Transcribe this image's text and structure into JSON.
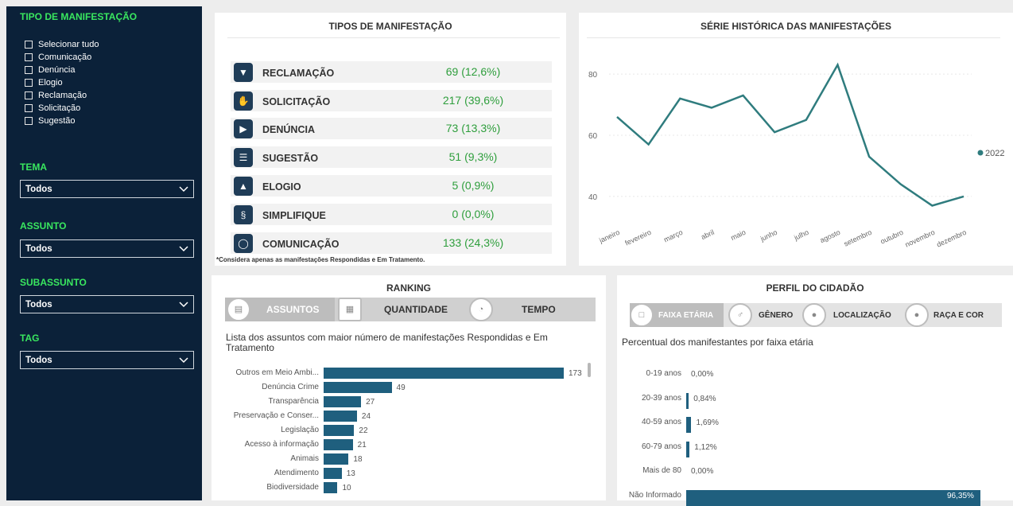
{
  "sidebar": {
    "tipo_title": "TIPO DE MANIFESTAÇÃO",
    "tipo_options": [
      "Selecionar tudo",
      "Comunicação",
      "Denúncia",
      "Elogio",
      "Reclamação",
      "Solicitação",
      "Sugestão"
    ],
    "tema_title": "TEMA",
    "tema_value": "Todos",
    "assunto_title": "ASSUNTO",
    "assunto_value": "Todos",
    "subassunto_title": "SUBASSUNTO",
    "subassunto_value": "Todos",
    "tag_title": "TAG",
    "tag_value": "Todos"
  },
  "tipos": {
    "title": "TIPOS DE MANIFESTAÇÃO",
    "rows": [
      {
        "label": "RECLAMAÇÃO",
        "value": "69 (12,6%)"
      },
      {
        "label": "SOLICITAÇÃO",
        "value": "217 (39,6%)"
      },
      {
        "label": "DENÚNCIA",
        "value": "73 (13,3%)"
      },
      {
        "label": "SUGESTÃO",
        "value": "51 (9,3%)"
      },
      {
        "label": "ELOGIO",
        "value": "5 (0,9%)"
      },
      {
        "label": "SIMPLIFIQUE",
        "value": "0 (0,0%)"
      },
      {
        "label": "COMUNICAÇÃO",
        "value": "133 (24,3%)"
      }
    ],
    "footnote": "*Considera apenas as manifestações Respondidas e Em Tratamento."
  },
  "serie": {
    "title": "SÉRIE HISTÓRICA DAS MANIFESTAÇÕES"
  },
  "ranking": {
    "title": "RANKING",
    "tabs": [
      "ASSUNTOS",
      "QUANTIDADE",
      "TEMPO"
    ],
    "subtitle": "Lista dos assuntos com maior número de manifestações Respondidas e Em Tratamento"
  },
  "perfil": {
    "title": "PERFIL DO CIDADÃO",
    "tabs": [
      "FAIXA ETÁRIA",
      "GÊNERO",
      "LOCALIZAÇÃO",
      "RAÇA E COR"
    ],
    "subtitle": "Percentual dos manifestantes por faixa etária"
  },
  "colors": {
    "accent_green": "#39e75f",
    "line": "#2f7c7e",
    "bar": "#1f5f7e",
    "sidebar": "#0b2139"
  },
  "chart_data": [
    {
      "type": "line",
      "title": "SÉRIE HISTÓRICA DAS MANIFESTAÇÕES",
      "x": [
        "janeiro",
        "fevereiro",
        "março",
        "abril",
        "maio",
        "junho",
        "julho",
        "agosto",
        "setembro",
        "outubro",
        "novembro",
        "dezembro"
      ],
      "series": [
        {
          "name": "2022",
          "values": [
            66,
            57,
            72,
            69,
            73,
            61,
            65,
            83,
            53,
            44,
            37,
            40
          ]
        }
      ],
      "yticks": [
        "40",
        "60",
        "80"
      ],
      "ylim": [
        34,
        86
      ],
      "grid": true,
      "legend": "right"
    },
    {
      "type": "bar",
      "orientation": "horizontal",
      "categories": [
        "Outros em Meio Ambi...",
        "Denúncia Crime",
        "Transparência",
        "Preservação e Conser...",
        "Legislação",
        "Acesso à informação",
        "Animais",
        "Atendimento",
        "Biodiversidade"
      ],
      "values": [
        173,
        49,
        27,
        24,
        22,
        21,
        18,
        13,
        10
      ],
      "value_labels": [
        "173",
        "49",
        "27",
        "24",
        "22",
        "21",
        "18",
        "13",
        "10"
      ]
    },
    {
      "type": "bar",
      "orientation": "horizontal",
      "categories": [
        "0-19 anos",
        "20-39 anos",
        "40-59 anos",
        "60-79 anos",
        "Mais de 80",
        "Não Informado"
      ],
      "values": [
        0.0,
        0.84,
        1.69,
        1.12,
        0.0,
        96.35
      ],
      "value_labels": [
        "0,00%",
        "0,84%",
        "1,69%",
        "1,12%",
        "0,00%",
        "96,35%"
      ]
    }
  ]
}
